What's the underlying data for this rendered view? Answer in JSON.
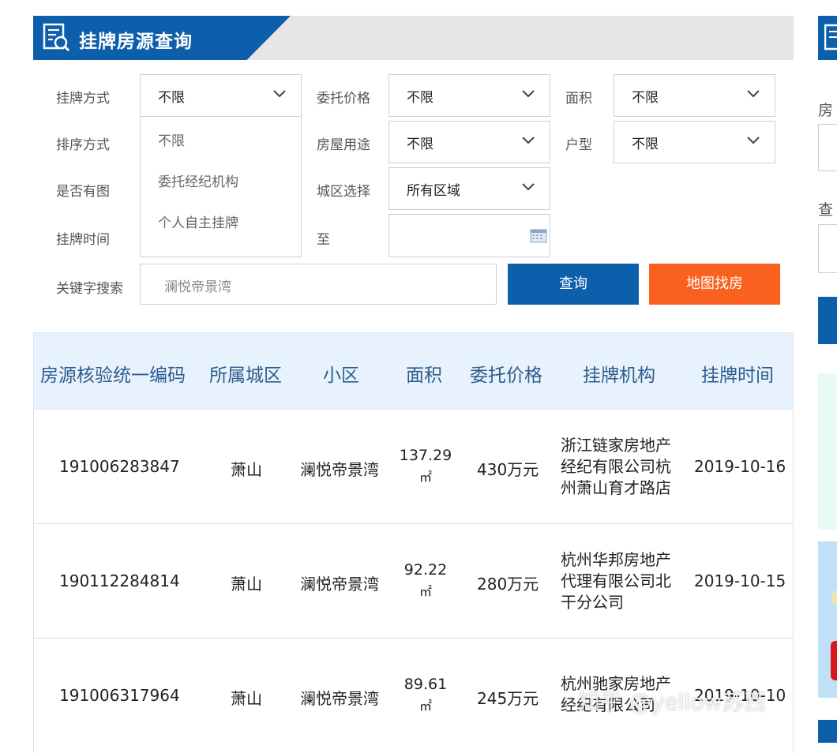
{
  "header": {
    "title": "挂牌房源查询"
  },
  "form": {
    "listing_method": {
      "label": "挂牌方式",
      "value": "不限",
      "options": [
        "不限",
        "委托经纪机构",
        "个人自主挂牌"
      ]
    },
    "sort_method": {
      "label": "排序方式"
    },
    "has_image": {
      "label": "是否有图"
    },
    "listing_time": {
      "label": "挂牌时间",
      "to_label": "至"
    },
    "price": {
      "label": "委托价格",
      "value": "不限"
    },
    "usage": {
      "label": "房屋用途",
      "value": "不限"
    },
    "district": {
      "label": "城区选择",
      "value": "所有区域"
    },
    "area": {
      "label": "面积",
      "value": "不限"
    },
    "layout": {
      "label": "户型",
      "value": "不限"
    },
    "keyword": {
      "label": "关键字搜索",
      "value": "澜悦帝景湾"
    },
    "search_button": "查询",
    "map_button": "地图找房"
  },
  "table": {
    "headers": [
      "房源核验统一编码",
      "所属城区",
      "小区",
      "面积",
      "委托价格",
      "挂牌机构",
      "挂牌时间"
    ],
    "rows": [
      {
        "code": "191006283847",
        "district": "萧山",
        "community": "澜悦帝景湾",
        "area": "137.29",
        "unit": "㎡",
        "price": "430万元",
        "agency": "浙江链家房地产经纪有限公司杭州萧山育才路店",
        "date": "2019-10-16"
      },
      {
        "code": "190112284814",
        "district": "萧山",
        "community": "澜悦帝景湾",
        "area": "92.22",
        "unit": "㎡",
        "price": "280万元",
        "agency": "杭州华邦房地产代理有限公司北干分公司",
        "date": "2019-10-15"
      },
      {
        "code": "191006317964",
        "district": "萧山",
        "community": "澜悦帝景湾",
        "area": "89.61",
        "unit": "㎡",
        "price": "245万元",
        "agency": "杭州驰家房地产经纪有限公司",
        "date": "2019-10-10"
      }
    ]
  },
  "sidebar": {
    "label1": "房",
    "label2": "查"
  },
  "watermark": "知乎 @yellow苏西",
  "colors": {
    "header_blue": "#0d5eab",
    "map_button": "#fa6120",
    "table_header_bg": "#e8f2fc"
  }
}
